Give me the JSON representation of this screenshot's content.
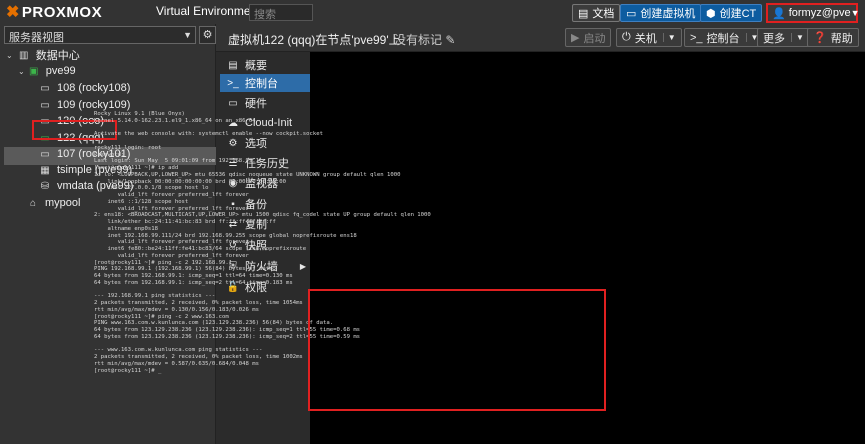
{
  "topbar": {
    "logo": "PROXMOX",
    "version": "Virtual Environment 8.2.2",
    "search_placeholder": "搜索",
    "docs_label": "文档",
    "create_vm_label": "创建虚拟机",
    "create_ct_label": "创建CT",
    "user_label": "formyz@pve"
  },
  "sidebar": {
    "view_label": "服务器视图",
    "tree": [
      {
        "label": "数据中心",
        "icon": "building-icon"
      },
      {
        "label": "pve99",
        "icon": "server-online-icon"
      },
      {
        "label": "108 (rocky108)",
        "icon": "monitor-icon"
      },
      {
        "label": "109 (rocky109)",
        "icon": "monitor-icon"
      },
      {
        "label": "120 (ooo)",
        "icon": "monitor-icon"
      },
      {
        "label": "122 (qqq)",
        "icon": "monitor-running-icon"
      },
      {
        "label": "107 (rocky101)",
        "icon": "monitor-icon"
      },
      {
        "label": "tsimple (pve99)",
        "icon": "grid-icon"
      },
      {
        "label": "vmdata (pve99)",
        "icon": "database-icon"
      },
      {
        "label": "mypool",
        "icon": "tag-icon"
      }
    ]
  },
  "main": {
    "title": "虚拟机122 (qqq)在节点'pve99'上",
    "tags_label": "没有标记",
    "start_label": "启动",
    "shutdown_label": "关机",
    "console_label": "控制台",
    "more_label": "更多",
    "help_label": "帮助"
  },
  "nav": [
    {
      "label": "概要",
      "icon": "book-icon"
    },
    {
      "label": "控制台",
      "icon": "terminal-icon"
    },
    {
      "label": "硬件",
      "icon": "desktop-icon"
    },
    {
      "label": "Cloud-Init",
      "icon": "cloud-icon"
    },
    {
      "label": "选项",
      "icon": "gear-icon"
    },
    {
      "label": "任务历史",
      "icon": "list-icon"
    },
    {
      "label": "监视器",
      "icon": "eye-icon"
    },
    {
      "label": "备份",
      "icon": "floppy-icon"
    },
    {
      "label": "复制",
      "icon": "retweet-icon"
    },
    {
      "label": "快照",
      "icon": "history-icon"
    },
    {
      "label": "防火墙",
      "icon": "shield-icon"
    },
    {
      "label": "权限",
      "icon": "unlock-icon"
    }
  ],
  "terminal": {
    "lines": [
      "Rocky Linux 9.1 (Blue Onyx)",
      "Kernel 5.14.0-162.23.1.el9_1.x86_64 on an x86_64",
      "",
      "Activate the web console with: systemctl enable --now cockpit.socket",
      "",
      "rocky111 login: root",
      "Password:",
      "Last login: Sun May  5 09:01:09 from 192.168.99.1",
      "[root@rocky111 ~]# ip add",
      "1: lo: <LOOPBACK,UP,LOWER_UP> mtu 65536 qdisc noqueue state UNKNOWN group default qlen 1000",
      "    link/loopback 00:00:00:00:00:00 brd 00:00:00:00:00:00",
      "    inet 127.0.0.1/8 scope host lo",
      "       valid_lft forever preferred_lft forever",
      "    inet6 ::1/128 scope host",
      "       valid_lft forever preferred_lft forever",
      "2: ens18: <BROADCAST,MULTICAST,UP,LOWER_UP> mtu 1500 qdisc fq_codel state UP group default qlen 1000",
      "    link/ether bc:24:11:41:bc:83 brd ff:ff:ff:ff:ff:ff",
      "    altname enp0s18",
      "    inet 192.168.99.111/24 brd 192.168.99.255 scope global noprefixroute ens18",
      "       valid_lft forever preferred_lft forever",
      "    inet6 fe80::be24:11ff:fe41:bc83/64 scope link noprefixroute",
      "       valid_lft forever preferred_lft forever",
      "[root@rocky111 ~]# ping -c 2 192.168.99.1",
      "PING 192.168.99.1 (192.168.99.1) 56(84) bytes of data.",
      "64 bytes from 192.168.99.1: icmp_seq=1 ttl=64 time=0.130 ms",
      "64 bytes from 192.168.99.1: icmp_seq=2 ttl=64 time=0.183 ms",
      "",
      "--- 192.168.99.1 ping statistics ---",
      "2 packets transmitted, 2 received, 0% packet loss, time 1054ms",
      "rtt min/avg/max/mdev = 0.130/0.156/0.183/0.026 ms",
      "[root@rocky111 ~]# ping -c 2 www.163.com",
      "PING www.163.com.w.kunlunca.com (123.129.238.236) 56(84) bytes of data.",
      "64 bytes from 123.129.238.236 (123.129.238.236): icmp_seq=1 ttl=55 time=0.68 ms",
      "64 bytes from 123.129.238.236 (123.129.238.236): icmp_seq=2 ttl=55 time=0.59 ms",
      "",
      "--- www.163.com.w.kunlunca.com ping statistics ---",
      "2 packets transmitted, 2 received, 0% packet loss, time 1002ms",
      "rtt min/avg/max/mdev = 0.587/0.635/0.684/0.048 ms",
      "[root@rocky111 ~]# _"
    ]
  },
  "colors": {
    "accent": "#2d6ca8",
    "highlight_box": "#e02020",
    "logo_x": "#e57000",
    "online": "#3cb54a"
  }
}
